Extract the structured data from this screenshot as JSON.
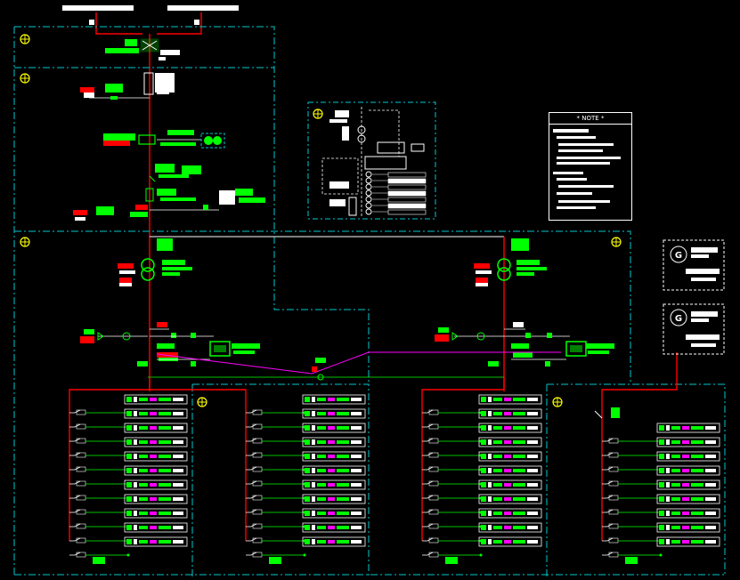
{
  "note": {
    "title": "* NOTE *"
  },
  "colors": {
    "background": "#000000",
    "feeder": "#ff0000",
    "boundary": "#00c8d0",
    "device": "#00ff00",
    "text_block": "#ffffff",
    "tie_line": "#ff00ff",
    "marker": "#ffff00"
  }
}
